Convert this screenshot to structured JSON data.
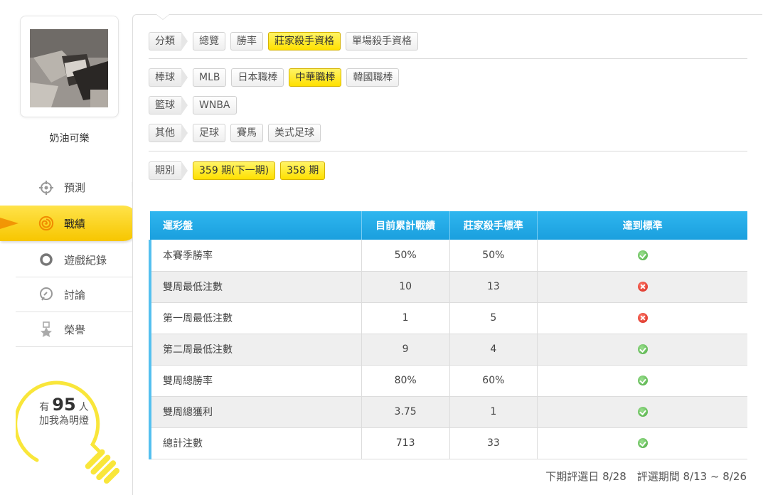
{
  "profile": {
    "username": "奶油可樂"
  },
  "menu": [
    {
      "label": "預測",
      "icon": "target-icon"
    },
    {
      "label": "戰績",
      "icon": "record-spiral-icon"
    },
    {
      "label": "遊戲紀錄",
      "icon": "ring-icon"
    },
    {
      "label": "討論",
      "icon": "chat-icon"
    },
    {
      "label": "榮譽",
      "icon": "medal-icon"
    }
  ],
  "fans": {
    "prefix": "有",
    "count": "95",
    "suffix": "人",
    "line2": "加我為明燈"
  },
  "filters": {
    "category": {
      "label": "分類",
      "items": [
        "總覽",
        "勝率",
        "莊家殺手資格",
        "單場殺手資格"
      ],
      "active": "莊家殺手資格"
    },
    "baseball": {
      "label": "棒球",
      "items": [
        "MLB",
        "日本職棒",
        "中華職棒",
        "韓國職棒"
      ],
      "active": "中華職棒"
    },
    "basketball": {
      "label": "籃球",
      "items": [
        "WNBA"
      ]
    },
    "other": {
      "label": "其他",
      "items": [
        "足球",
        "賽馬",
        "美式足球"
      ]
    },
    "period": {
      "label": "期別",
      "items": [
        "359 期(下一期)",
        "358 期"
      ]
    }
  },
  "table": {
    "headers": [
      "運彩盤",
      "目前累計戰績",
      "莊家殺手標準",
      "達到標準"
    ],
    "rows": [
      {
        "name": "本賽季勝率",
        "current": "50%",
        "standard": "50%",
        "pass": true
      },
      {
        "name": "雙周最低注數",
        "current": "10",
        "standard": "13",
        "pass": false
      },
      {
        "name": "第一周最低注數",
        "current": "1",
        "standard": "5",
        "pass": false
      },
      {
        "name": "第二周最低注數",
        "current": "9",
        "standard": "4",
        "pass": true
      },
      {
        "name": "雙周總勝率",
        "current": "80%",
        "standard": "60%",
        "pass": true
      },
      {
        "name": "雙周總獲利",
        "current": "3.75",
        "standard": "1",
        "pass": true
      },
      {
        "name": "總計注數",
        "current": "713",
        "standard": "33",
        "pass": true
      }
    ]
  },
  "footer": {
    "note": "下期評選日 8/28　評選期間 8/13 ~ 8/26"
  },
  "colors": {
    "accent_yellow": "#ffe000",
    "header_blue": "#1a9fde",
    "ok_green": "#4aa93e",
    "fail_red": "#d4241a"
  }
}
